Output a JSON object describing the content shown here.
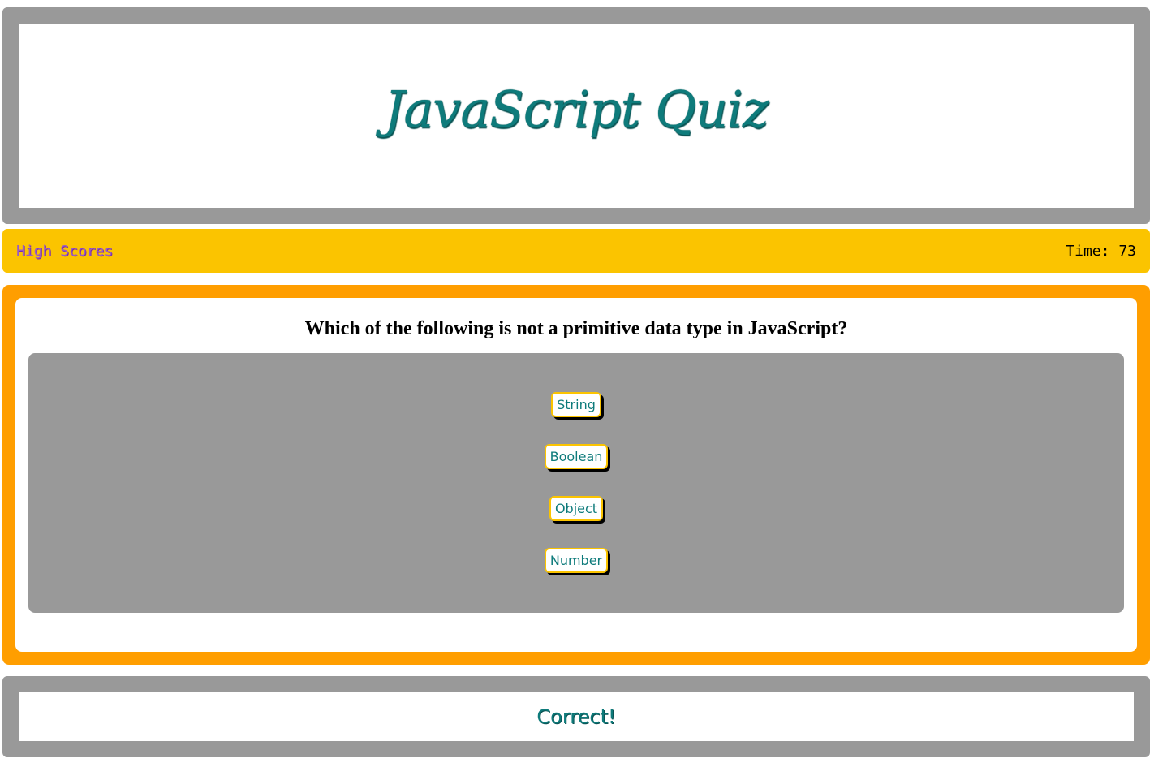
{
  "header": {
    "title": "JavaScript Quiz"
  },
  "topbar": {
    "high_scores_label": "High Scores",
    "timer_text": "Time: 73"
  },
  "quiz": {
    "question": "Which of the following is not a primitive data type in JavaScript?",
    "choices": [
      "String",
      "Boolean",
      "Object",
      "Number"
    ]
  },
  "result": {
    "message": "Correct!"
  },
  "colors": {
    "accent_teal": "#0e7b7b",
    "topbar_yellow": "#fbc400",
    "quiz_orange": "#ff9e00",
    "frame_gray": "#999999",
    "link_purple": "#9a5cc4"
  }
}
